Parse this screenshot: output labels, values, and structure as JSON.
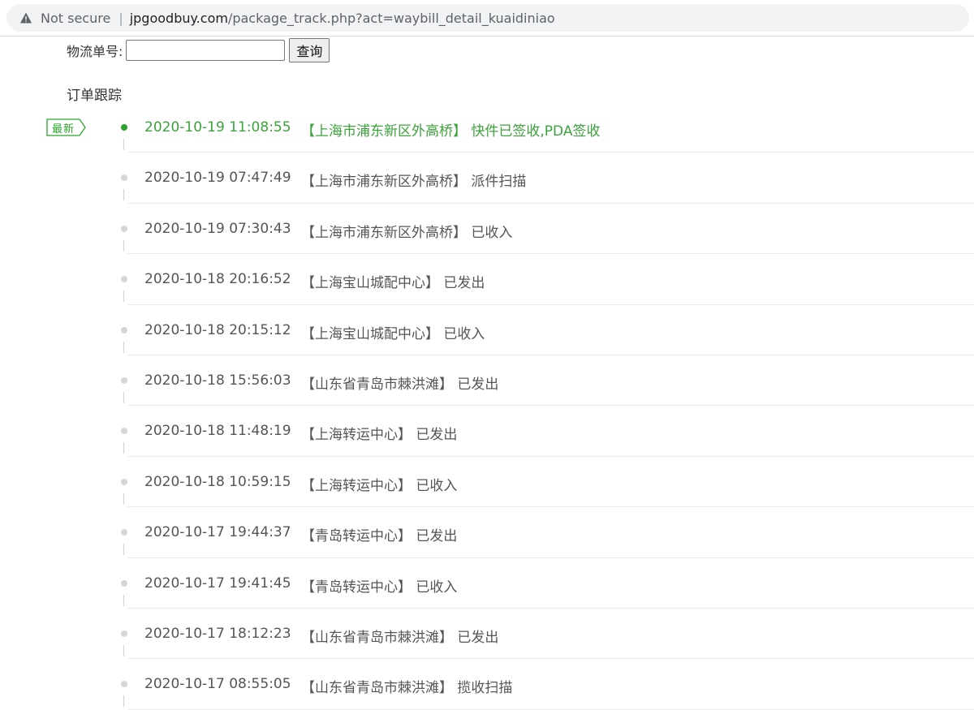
{
  "browser": {
    "security_label": "Not secure",
    "separator": "|",
    "url_host": "jpgoodbuy.com",
    "url_path": "/package_track.php?act=waybill_detail_kuaidiniao",
    "warning_icon": "warning-triangle-icon"
  },
  "search": {
    "label": "物流单号:",
    "input_value": "",
    "button_label": "查询"
  },
  "section_title": "订单跟踪",
  "latest_badge": "最新",
  "colors": {
    "latest_green": "#3ca23c",
    "normal_text": "#555555",
    "dot_gray": "#d6d6d6"
  },
  "timeline": [
    {
      "time": "2020-10-19 11:08:55",
      "desc": "【上海市浦东新区外高桥】 快件已签收,PDA签收"
    },
    {
      "time": "2020-10-19 07:47:49",
      "desc": "【上海市浦东新区外高桥】 派件扫描"
    },
    {
      "time": "2020-10-19 07:30:43",
      "desc": "【上海市浦东新区外高桥】 已收入"
    },
    {
      "time": "2020-10-18 20:16:52",
      "desc": "【上海宝山城配中心】 已发出"
    },
    {
      "time": "2020-10-18 20:15:12",
      "desc": "【上海宝山城配中心】 已收入"
    },
    {
      "time": "2020-10-18 15:56:03",
      "desc": "【山东省青岛市棘洪滩】 已发出"
    },
    {
      "time": "2020-10-18 11:48:19",
      "desc": "【上海转运中心】 已发出"
    },
    {
      "time": "2020-10-18 10:59:15",
      "desc": "【上海转运中心】 已收入"
    },
    {
      "time": "2020-10-17 19:44:37",
      "desc": "【青岛转运中心】 已发出"
    },
    {
      "time": "2020-10-17 19:41:45",
      "desc": "【青岛转运中心】 已收入"
    },
    {
      "time": "2020-10-17 18:12:23",
      "desc": "【山东省青岛市棘洪滩】 已发出"
    },
    {
      "time": "2020-10-17 08:55:05",
      "desc": "【山东省青岛市棘洪滩】 揽收扫描"
    }
  ]
}
